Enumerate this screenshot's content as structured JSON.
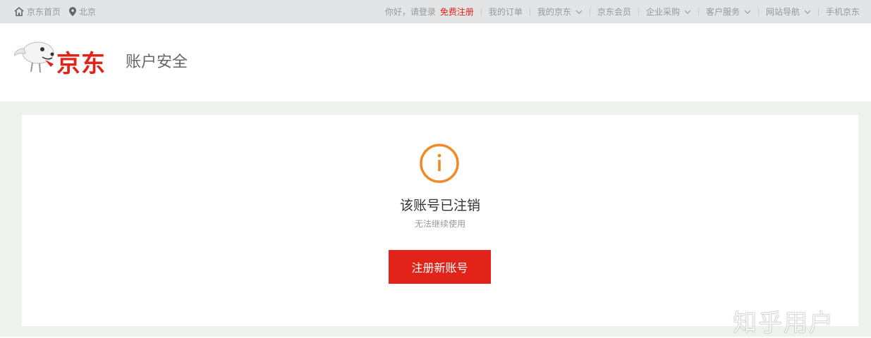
{
  "topbar": {
    "home_label": "京东首页",
    "location_label": "北京",
    "greeting": "你好，请登录",
    "register_link": "免费注册",
    "nav_items": [
      {
        "label": "我的订单",
        "has_dropdown": false
      },
      {
        "label": "我的京东",
        "has_dropdown": true
      },
      {
        "label": "京东会员",
        "has_dropdown": false
      },
      {
        "label": "企业采购",
        "has_dropdown": true
      },
      {
        "label": "客户服务",
        "has_dropdown": true
      },
      {
        "label": "网站导航",
        "has_dropdown": true
      },
      {
        "label": "手机京东",
        "has_dropdown": false
      }
    ]
  },
  "header": {
    "logo_text": "京东",
    "title": "账户安全"
  },
  "message": {
    "icon": "info-icon",
    "icon_color": "#f08a24",
    "title": "该账号已注销",
    "subtitle": "无法继续使用"
  },
  "actions": {
    "register_button": "注册新账号"
  },
  "watermark": "知乎用户",
  "colors": {
    "brand_red": "#e2231a",
    "topbar_bg": "#e3e4e5",
    "page_bg": "#eef2ee"
  }
}
